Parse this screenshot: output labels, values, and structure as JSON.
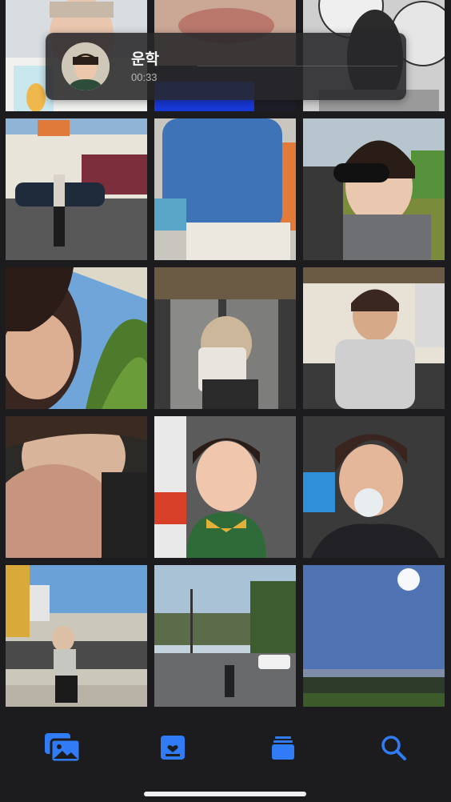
{
  "now_playing": {
    "name": "운학",
    "duration": "00:33",
    "progress": 0
  },
  "photos": [
    {
      "label": "photo-1"
    },
    {
      "label": "photo-2"
    },
    {
      "label": "photo-3"
    },
    {
      "label": "photo-4"
    },
    {
      "label": "photo-5"
    },
    {
      "label": "photo-6"
    },
    {
      "label": "photo-7"
    },
    {
      "label": "photo-8"
    },
    {
      "label": "photo-9"
    },
    {
      "label": "photo-10"
    },
    {
      "label": "photo-11"
    },
    {
      "label": "photo-12"
    },
    {
      "label": "photo-13"
    },
    {
      "label": "photo-14"
    },
    {
      "label": "photo-15"
    },
    {
      "label": "photo-16"
    },
    {
      "label": "photo-17"
    },
    {
      "label": "photo-18"
    }
  ],
  "tabbar": {
    "tabs": [
      {
        "icon": "photos-icon",
        "selected": true
      },
      {
        "icon": "memories-icon",
        "selected": false
      },
      {
        "icon": "albums-icon",
        "selected": false
      },
      {
        "icon": "search-icon",
        "selected": false
      }
    ],
    "accent": "#2f7cf6"
  },
  "colors": {
    "background": "#1c1c1e",
    "banner": "#28282a"
  }
}
